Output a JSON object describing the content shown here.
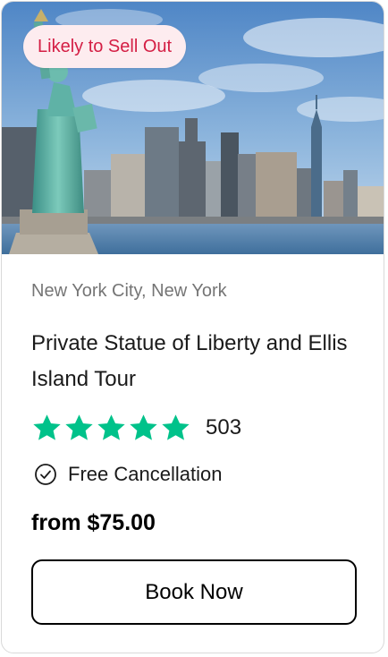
{
  "badge": {
    "label": "Likely to Sell Out",
    "bg_color": "#fdecef",
    "text_color": "#d41e44"
  },
  "image": {
    "subject": "Statue of Liberty with New York City skyline"
  },
  "product": {
    "location": "New York City, New York",
    "title": "Private Statue of Liberty and Ellis Island Tour",
    "rating": 5,
    "rating_max": 5,
    "review_count": "503",
    "star_color": "#00c28a",
    "star_icon": "star-icon",
    "free_cancellation_icon": "check-circle-icon",
    "free_cancellation_label": "Free Cancellation",
    "price": "from $75.00"
  },
  "actions": {
    "book_label": "Book Now"
  }
}
